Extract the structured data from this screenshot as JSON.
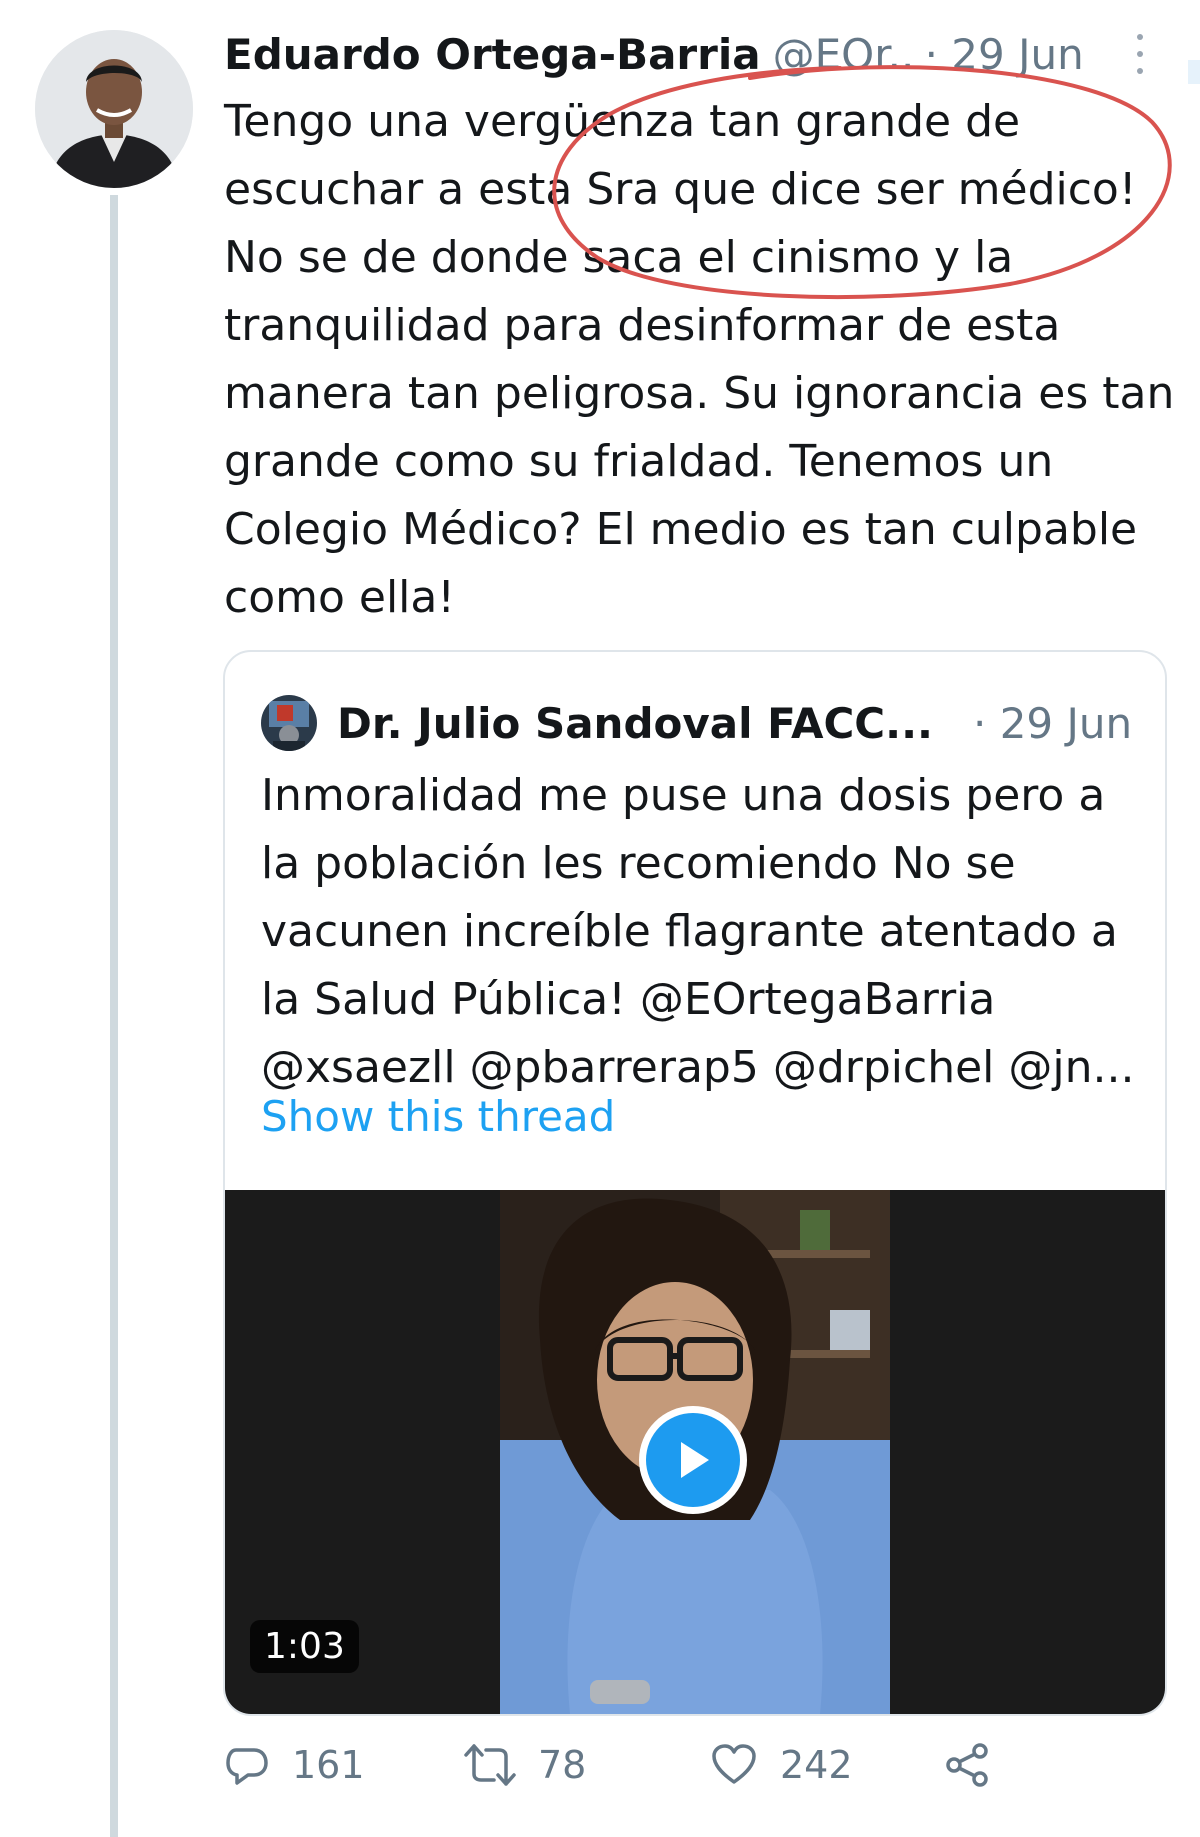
{
  "tweet": {
    "author_name": "Eduardo Ortega-Barria",
    "author_handle": "@EOr...",
    "date": "· 29 Jun",
    "text": "Tengo una vergüenza tan grande de escuchar a esta Sra que dice ser médico! No se de donde saca el cinismo y la tranquilidad para desinformar de esta manera tan peligrosa. Su ignorancia es tan grande como su frialdad. Tenemos un Colegio Médico? El medio es tan culpable como ella!",
    "actions": {
      "replies": "161",
      "retweets": "78",
      "likes": "242"
    }
  },
  "quoted_tweet": {
    "author_name": "Dr. Julio Sandoval FACC...",
    "date": "· 29 Jun",
    "text": "Inmoralidad me puse una dosis pero a la población les recomiendo No se vacunen increíble flagrante atentado a la Salud Pública! @EOrtegaBarria @xsaezll @pbarrerap5 @drpichel @jn...",
    "show_thread": "Show this thread",
    "video": {
      "duration": "1:03"
    }
  },
  "icons": {
    "more": "more-vertical-icon",
    "play": "play-icon",
    "reply": "reply-icon",
    "retweet": "retweet-icon",
    "like": "heart-icon",
    "share": "share-icon"
  },
  "colors": {
    "link": "#1da1f2",
    "secondary_text": "#657786",
    "annotation": "#d9534f",
    "play_button": "#1d9bf0"
  }
}
